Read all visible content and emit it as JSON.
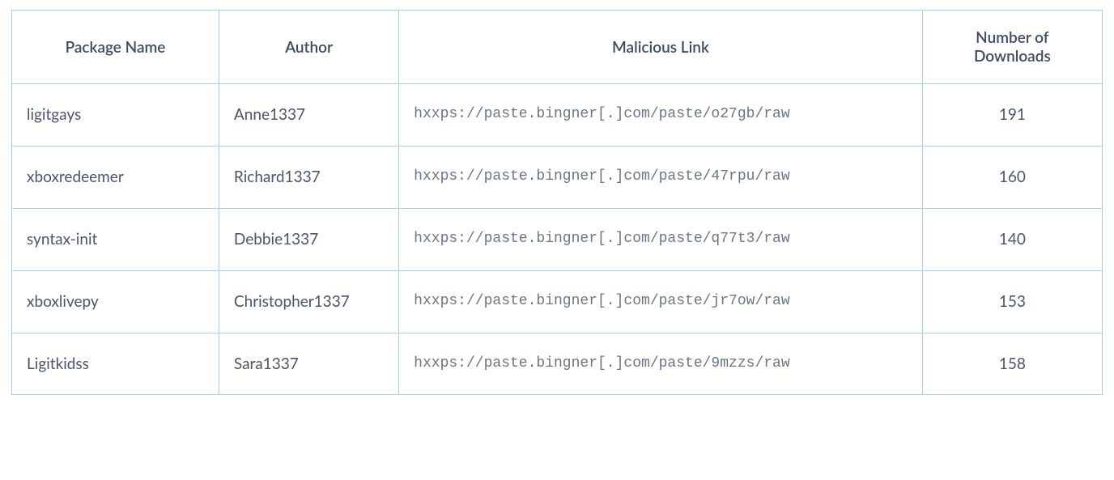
{
  "table": {
    "headers": {
      "package_name": "Package Name",
      "author": "Author",
      "malicious_link": "Malicious Link",
      "downloads": "Number of Downloads"
    },
    "rows": [
      {
        "package_name": "ligitgays",
        "author": "Anne1337",
        "malicious_link": "hxxps://paste.bingner[.]com/paste/o27gb/raw",
        "downloads": "191"
      },
      {
        "package_name": "xboxredeemer",
        "author": "Richard1337",
        "malicious_link": "hxxps://paste.bingner[.]com/paste/47rpu/raw",
        "downloads": "160"
      },
      {
        "package_name": "syntax-init",
        "author": "Debbie1337",
        "malicious_link": "hxxps://paste.bingner[.]com/paste/q77t3/raw",
        "downloads": "140"
      },
      {
        "package_name": "xboxlivepy",
        "author": "Christopher1337",
        "malicious_link": "hxxps://paste.bingner[.]com/paste/jr7ow/raw",
        "downloads": "153"
      },
      {
        "package_name": "Ligitkidss",
        "author": "Sara1337",
        "malicious_link": "hxxps://paste.bingner[.]com/paste/9mzzs/raw",
        "downloads": "158"
      }
    ]
  }
}
